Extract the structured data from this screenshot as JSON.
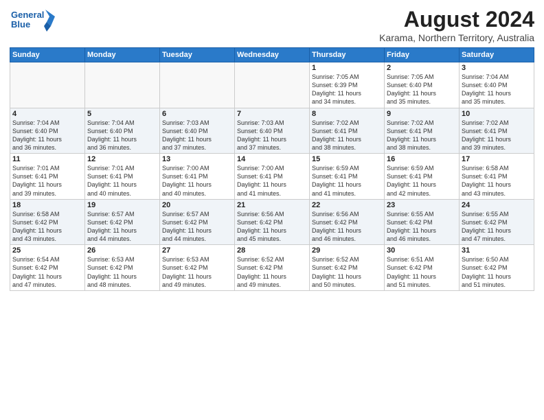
{
  "title": "August 2024",
  "location": "Karama, Northern Territory, Australia",
  "logo": {
    "line1": "General",
    "line2": "Blue"
  },
  "headers": [
    "Sunday",
    "Monday",
    "Tuesday",
    "Wednesday",
    "Thursday",
    "Friday",
    "Saturday"
  ],
  "weeks": [
    [
      {
        "day": "",
        "info": ""
      },
      {
        "day": "",
        "info": ""
      },
      {
        "day": "",
        "info": ""
      },
      {
        "day": "",
        "info": ""
      },
      {
        "day": "1",
        "info": "Sunrise: 7:05 AM\nSunset: 6:39 PM\nDaylight: 11 hours\nand 34 minutes."
      },
      {
        "day": "2",
        "info": "Sunrise: 7:05 AM\nSunset: 6:40 PM\nDaylight: 11 hours\nand 35 minutes."
      },
      {
        "day": "3",
        "info": "Sunrise: 7:04 AM\nSunset: 6:40 PM\nDaylight: 11 hours\nand 35 minutes."
      }
    ],
    [
      {
        "day": "4",
        "info": "Sunrise: 7:04 AM\nSunset: 6:40 PM\nDaylight: 11 hours\nand 36 minutes."
      },
      {
        "day": "5",
        "info": "Sunrise: 7:04 AM\nSunset: 6:40 PM\nDaylight: 11 hours\nand 36 minutes."
      },
      {
        "day": "6",
        "info": "Sunrise: 7:03 AM\nSunset: 6:40 PM\nDaylight: 11 hours\nand 37 minutes."
      },
      {
        "day": "7",
        "info": "Sunrise: 7:03 AM\nSunset: 6:40 PM\nDaylight: 11 hours\nand 37 minutes."
      },
      {
        "day": "8",
        "info": "Sunrise: 7:02 AM\nSunset: 6:41 PM\nDaylight: 11 hours\nand 38 minutes."
      },
      {
        "day": "9",
        "info": "Sunrise: 7:02 AM\nSunset: 6:41 PM\nDaylight: 11 hours\nand 38 minutes."
      },
      {
        "day": "10",
        "info": "Sunrise: 7:02 AM\nSunset: 6:41 PM\nDaylight: 11 hours\nand 39 minutes."
      }
    ],
    [
      {
        "day": "11",
        "info": "Sunrise: 7:01 AM\nSunset: 6:41 PM\nDaylight: 11 hours\nand 39 minutes."
      },
      {
        "day": "12",
        "info": "Sunrise: 7:01 AM\nSunset: 6:41 PM\nDaylight: 11 hours\nand 40 minutes."
      },
      {
        "day": "13",
        "info": "Sunrise: 7:00 AM\nSunset: 6:41 PM\nDaylight: 11 hours\nand 40 minutes."
      },
      {
        "day": "14",
        "info": "Sunrise: 7:00 AM\nSunset: 6:41 PM\nDaylight: 11 hours\nand 41 minutes."
      },
      {
        "day": "15",
        "info": "Sunrise: 6:59 AM\nSunset: 6:41 PM\nDaylight: 11 hours\nand 41 minutes."
      },
      {
        "day": "16",
        "info": "Sunrise: 6:59 AM\nSunset: 6:41 PM\nDaylight: 11 hours\nand 42 minutes."
      },
      {
        "day": "17",
        "info": "Sunrise: 6:58 AM\nSunset: 6:41 PM\nDaylight: 11 hours\nand 43 minutes."
      }
    ],
    [
      {
        "day": "18",
        "info": "Sunrise: 6:58 AM\nSunset: 6:42 PM\nDaylight: 11 hours\nand 43 minutes."
      },
      {
        "day": "19",
        "info": "Sunrise: 6:57 AM\nSunset: 6:42 PM\nDaylight: 11 hours\nand 44 minutes."
      },
      {
        "day": "20",
        "info": "Sunrise: 6:57 AM\nSunset: 6:42 PM\nDaylight: 11 hours\nand 44 minutes."
      },
      {
        "day": "21",
        "info": "Sunrise: 6:56 AM\nSunset: 6:42 PM\nDaylight: 11 hours\nand 45 minutes."
      },
      {
        "day": "22",
        "info": "Sunrise: 6:56 AM\nSunset: 6:42 PM\nDaylight: 11 hours\nand 46 minutes."
      },
      {
        "day": "23",
        "info": "Sunrise: 6:55 AM\nSunset: 6:42 PM\nDaylight: 11 hours\nand 46 minutes."
      },
      {
        "day": "24",
        "info": "Sunrise: 6:55 AM\nSunset: 6:42 PM\nDaylight: 11 hours\nand 47 minutes."
      }
    ],
    [
      {
        "day": "25",
        "info": "Sunrise: 6:54 AM\nSunset: 6:42 PM\nDaylight: 11 hours\nand 47 minutes."
      },
      {
        "day": "26",
        "info": "Sunrise: 6:53 AM\nSunset: 6:42 PM\nDaylight: 11 hours\nand 48 minutes."
      },
      {
        "day": "27",
        "info": "Sunrise: 6:53 AM\nSunset: 6:42 PM\nDaylight: 11 hours\nand 49 minutes."
      },
      {
        "day": "28",
        "info": "Sunrise: 6:52 AM\nSunset: 6:42 PM\nDaylight: 11 hours\nand 49 minutes."
      },
      {
        "day": "29",
        "info": "Sunrise: 6:52 AM\nSunset: 6:42 PM\nDaylight: 11 hours\nand 50 minutes."
      },
      {
        "day": "30",
        "info": "Sunrise: 6:51 AM\nSunset: 6:42 PM\nDaylight: 11 hours\nand 51 minutes."
      },
      {
        "day": "31",
        "info": "Sunrise: 6:50 AM\nSunset: 6:42 PM\nDaylight: 11 hours\nand 51 minutes."
      }
    ]
  ]
}
